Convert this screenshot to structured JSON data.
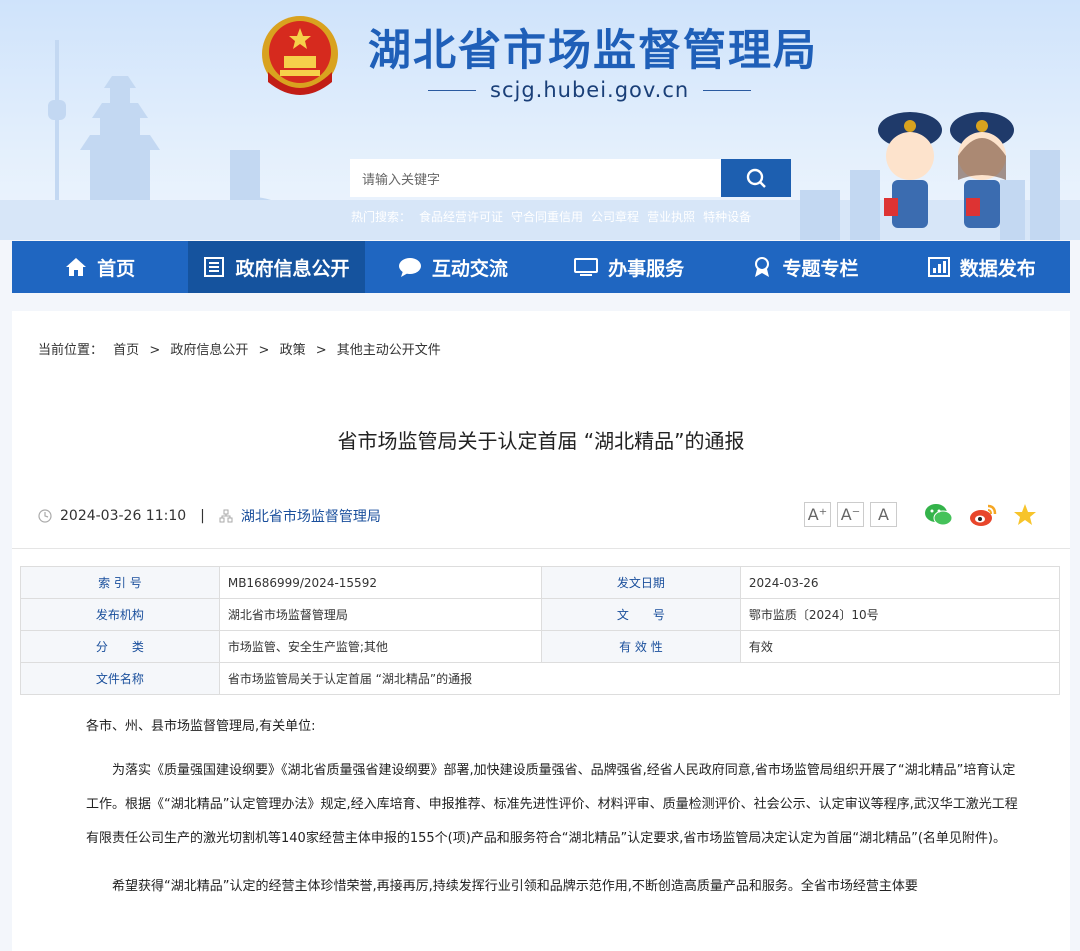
{
  "header": {
    "site_title": "湖北省市场监督管理局",
    "domain": "scjg.hubei.gov.cn",
    "search_placeholder": "请输入关键字",
    "hot_label": "热门搜索：",
    "hot_terms": [
      "食品经营许可证",
      "守合同重信用",
      "公司章程",
      "营业执照",
      "特种设备"
    ]
  },
  "nav": [
    {
      "label": "首页",
      "icon": "home-icon"
    },
    {
      "label": "政府信息公开",
      "icon": "document-list-icon"
    },
    {
      "label": "互动交流",
      "icon": "chat-bubble-icon"
    },
    {
      "label": "办事服务",
      "icon": "monitor-icon"
    },
    {
      "label": "专题专栏",
      "icon": "ribbon-icon"
    },
    {
      "label": "数据发布",
      "icon": "chart-icon"
    }
  ],
  "breadcrumb": {
    "label": "当前位置：",
    "items": [
      "首页",
      "政府信息公开",
      "政策",
      "其他主动公开文件"
    ],
    "separator": ">"
  },
  "article": {
    "title": "省市场监管局关于认定首届 “湖北精品”的通报",
    "datetime": "2024-03-26 11:10",
    "divider": "|",
    "publisher": "湖北省市场监督管理局",
    "font_buttons": [
      "A⁺",
      "A⁻",
      "A"
    ]
  },
  "info_table": {
    "rows": [
      {
        "k1": "索 引 号",
        "v1": "MB1686999/2024-15592",
        "k2": "发文日期",
        "v2": "2024-03-26"
      },
      {
        "k1": "发布机构",
        "v1": "湖北省市场监督管理局",
        "k2": "文　　号",
        "v2": "鄂市监质〔2024〕10号"
      },
      {
        "k1": "分　　类",
        "v1": "市场监管、安全生产监管;其他",
        "k2": "有 效 性",
        "v2": "有效"
      }
    ],
    "file_name_key": "文件名称",
    "file_name_value": "省市场监管局关于认定首届 “湖北精品”的通报"
  },
  "body": {
    "salutation": "各市、州、县市场监督管理局,有关单位:",
    "paragraph1": "为落实《质量强国建设纲要》《湖北省质量强省建设纲要》部署,加快建设质量强省、品牌强省,经省人民政府同意,省市场监管局组织开展了“湖北精品”培育认定工作。根据《“湖北精品”认定管理办法》规定,经入库培育、申报推荐、标准先进性评价、材料评审、质量检测评价、社会公示、认定审议等程序,武汉华工激光工程有限责任公司生产的激光切割机等140家经营主体申报的155个(项)产品和服务符合“湖北精品”认定要求,省市场监管局决定认定为首届“湖北精品”(名单见附件)。",
    "paragraph2": "希望获得“湖北精品”认定的经营主体珍惜荣誉,再接再厉,持续发挥行业引领和品牌示范作用,不断创造高质量产品和服务。全省市场经营主体要"
  },
  "colors": {
    "brand_blue": "#1f66c1",
    "nav_active": "#15539e",
    "title_blue": "#1f5fb8"
  }
}
